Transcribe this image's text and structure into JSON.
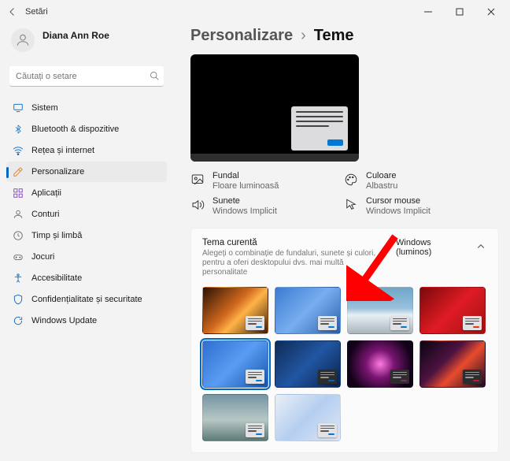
{
  "titlebar": {
    "app_name": "Setări"
  },
  "profile": {
    "name": "Diana Ann Roe",
    "subtitle": ""
  },
  "search": {
    "placeholder": "Căutați o setare"
  },
  "nav": [
    {
      "label": "Sistem",
      "icon": "system"
    },
    {
      "label": "Bluetooth & dispozitive",
      "icon": "bluetooth"
    },
    {
      "label": "Rețea și internet",
      "icon": "network"
    },
    {
      "label": "Personalizare",
      "icon": "personalize",
      "selected": true
    },
    {
      "label": "Aplicații",
      "icon": "apps"
    },
    {
      "label": "Conturi",
      "icon": "accounts"
    },
    {
      "label": "Timp și limbă",
      "icon": "time"
    },
    {
      "label": "Jocuri",
      "icon": "gaming"
    },
    {
      "label": "Accesibilitate",
      "icon": "accessibility"
    },
    {
      "label": "Confidențialitate și securitate",
      "icon": "privacy"
    },
    {
      "label": "Windows Update",
      "icon": "update"
    }
  ],
  "breadcrumb": {
    "parent": "Personalizare",
    "leaf": "Teme"
  },
  "props": {
    "background": {
      "label": "Fundal",
      "value": "Floare luminoasă"
    },
    "color": {
      "label": "Culoare",
      "value": "Albastru"
    },
    "sounds": {
      "label": "Sunete",
      "value": "Windows Implicit"
    },
    "cursor": {
      "label": "Cursor mouse",
      "value": "Windows Implicit"
    }
  },
  "card": {
    "title": "Tema curentă",
    "subtitle": "Alegeți o combinație de fundaluri, sunete și culori, pentru a oferi desktopului dvs. mai multă personalitate",
    "current": "Windows (luminos)"
  },
  "themes": [
    {
      "name": "fireplace",
      "accent": "#0078d4",
      "bg": "linear-gradient(135deg,#2a1205,#d2691e 45%,#ffb347 60%,#3a1e0a)",
      "dark": false
    },
    {
      "name": "bloom-blue",
      "accent": "#0078d4",
      "bg": "linear-gradient(135deg,#3b7bd1,#78aef0,#2a5fa8)",
      "dark": false
    },
    {
      "name": "winter",
      "accent": "#0078d4",
      "bg": "linear-gradient(180deg,#6ea6c8,#99c0dc 45%,#e8eff4 60%,#a9b7be)",
      "dark": false
    },
    {
      "name": "santa-red",
      "accent": "#e3350d",
      "bg": "linear-gradient(135deg,#7a0a0a,#e01b24,#9e1212)",
      "dark": false
    },
    {
      "name": "windows-light",
      "accent": "#0078d4",
      "bg": "linear-gradient(135deg,#2e6fd0,#5a9bf3,#1554a8)",
      "dark": false,
      "selected": true
    },
    {
      "name": "windows-dark",
      "accent": "#0067c0",
      "bg": "linear-gradient(135deg,#0f2b55,#2156a3,#09224a)",
      "dark": true
    },
    {
      "name": "glow",
      "accent": "#7b2d6c",
      "bg": "radial-gradient(circle at 50% 50%,#ff7ae0 0%,#7a1573 35%,#120218 80%)",
      "dark": true
    },
    {
      "name": "captured",
      "accent": "#d01030",
      "bg": "linear-gradient(135deg,#0a0512,#4c1240 40%,#e84b2d 60%,#1a0a22)",
      "dark": true
    },
    {
      "name": "landscape",
      "accent": "#0078d4",
      "bg": "linear-gradient(180deg,#7695a3,#b7c7c4 55%,#5e7b78)",
      "dark": false
    },
    {
      "name": "flow",
      "accent": "#0078d4",
      "bg": "linear-gradient(135deg,#e9eff6,#b5cef0,#dfe8f4)",
      "dark": false
    }
  ],
  "colors": {
    "accent": "#0067c0"
  }
}
